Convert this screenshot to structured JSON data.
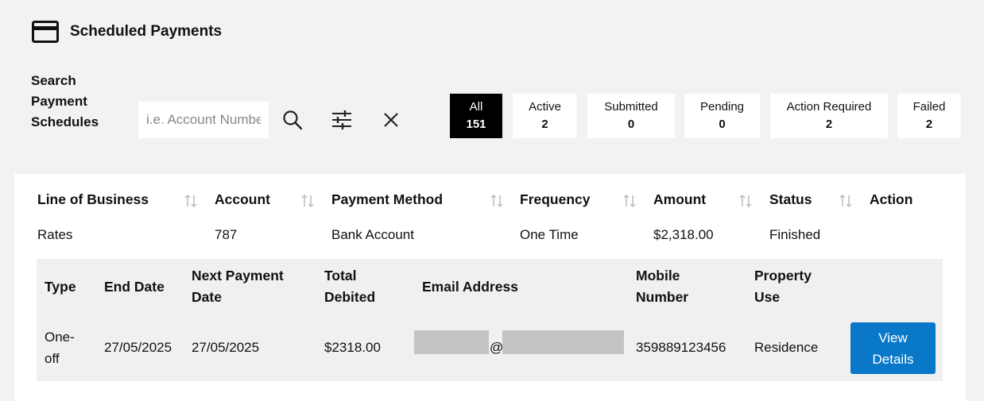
{
  "header": {
    "title": "Scheduled Payments",
    "icon": "credit-card-icon"
  },
  "search": {
    "label": "Search Payment Schedules",
    "placeholder": "i.e. Account Number",
    "value": ""
  },
  "filters": [
    {
      "label": "All",
      "count": "151",
      "active": true
    },
    {
      "label": "Active",
      "count": "2",
      "active": false
    },
    {
      "label": "Submitted",
      "count": "0",
      "active": false
    },
    {
      "label": "Pending",
      "count": "0",
      "active": false
    },
    {
      "label": "Action Required",
      "count": "2",
      "active": false
    },
    {
      "label": "Failed",
      "count": "2",
      "active": false
    }
  ],
  "table": {
    "columns": [
      "Line of Business",
      "Account",
      "Payment Method",
      "Frequency",
      "Amount",
      "Status",
      "Action"
    ],
    "row": [
      "Rates",
      "787",
      "Bank Account",
      "One Time",
      "$2,318.00",
      "Finished"
    ],
    "detail": {
      "headers": {
        "type": "Type",
        "end_date": "End Date",
        "next_payment_date": "Next Payment Date",
        "total_debited": "Total Debited",
        "email": "Email Address",
        "mobile": "Mobile Number",
        "property_use": "Property Use"
      },
      "values": {
        "type": "One-off",
        "end_date": "27/05/2025",
        "next_payment_date": "27/05/2025",
        "total_debited": "$2318.00",
        "email_at": "@",
        "mobile": "359889123456",
        "property_use": "Residence"
      },
      "view_button": "View Details"
    }
  },
  "colors": {
    "accent": "#0a78c8",
    "active_filter": "#000000",
    "background": "#f2f2f2"
  }
}
